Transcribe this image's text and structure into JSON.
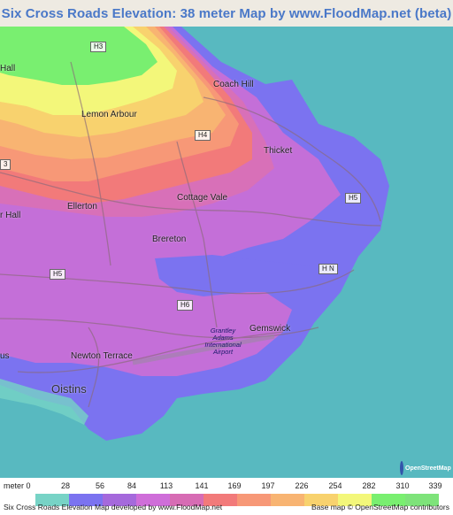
{
  "title": "Six Cross Roads Elevation: 38 meter Map by www.FloodMap.net (beta)",
  "map": {
    "places": {
      "coach_hill": "Coach Hill",
      "lemon_arbour": "Lemon Arbour",
      "thicket": "Thicket",
      "cottage_vale": "Cottage Vale",
      "ellerton": "Ellerton",
      "hall_top": "Hall",
      "hall_mid": "r Hall",
      "brereton": "Brereton",
      "gemswick": "Gemswick",
      "newton_terrace": "Newton Terrace",
      "oistins": "Oistins",
      "us": "us"
    },
    "roads": {
      "h3_top": "H3",
      "h3_left": "3",
      "h4": "H4",
      "h5_right": "H5",
      "h5_left": "H5",
      "h6": "H6",
      "hn": "H N"
    },
    "airport": {
      "line1": "Grantley",
      "line2": "Adams International",
      "line3": "Airport"
    },
    "osm_badge": "OpenStreetMap",
    "colors": {
      "sea": "#58b9c0",
      "level_0": "#77d3c6",
      "level_1": "#7b73f0",
      "level_2": "#a569dc",
      "level_3": "#cf6ed9",
      "level_4": "#d76cb4",
      "level_5": "#f27a7a",
      "level_6": "#f79877",
      "level_7": "#f8b472",
      "level_8": "#f8d26e",
      "level_9": "#f3f77a",
      "level_10": "#79ef70",
      "level_11": "#7ee37a"
    }
  },
  "legend": {
    "unit_label": "meter 0",
    "ticks": [
      "28",
      "56",
      "84",
      "113",
      "141",
      "169",
      "197",
      "226",
      "254",
      "282",
      "310",
      "339"
    ],
    "colors": [
      "#77d3c6",
      "#7b73f0",
      "#a569dc",
      "#cf6ed9",
      "#d76cb4",
      "#f27a7a",
      "#f79877",
      "#f8b472",
      "#f8d26e",
      "#f3f77a",
      "#79ef70",
      "#7ee37a"
    ]
  },
  "footer": {
    "left": "Six Cross Roads Elevation Map developed by www.FloodMap.net",
    "right": "Base map © OpenStreetMap contributors"
  }
}
